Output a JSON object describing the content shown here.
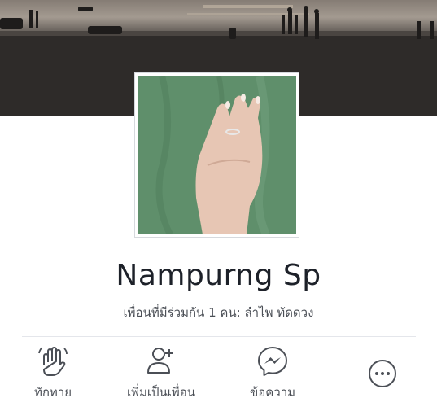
{
  "profile": {
    "name": "Nampurng Sp",
    "mutual": "เพื่อนที่มีร่วมกัน 1 คน: ลำไพ ทัดดวง"
  },
  "actions": [
    {
      "label": "ทักทาย",
      "icon": "wave-hand-icon"
    },
    {
      "label": "เพิ่มเป็นเพื่อน",
      "icon": "add-friend-icon"
    },
    {
      "label": "ข้อความ",
      "icon": "messenger-icon"
    },
    {
      "label": "",
      "icon": "more-options-icon"
    }
  ],
  "colors": {
    "icon": "#4b4f56",
    "text": "#1d2129",
    "subtext": "#4b4f56",
    "divider": "#e4e6eb",
    "avatar_bg": "#5f8f6b"
  }
}
